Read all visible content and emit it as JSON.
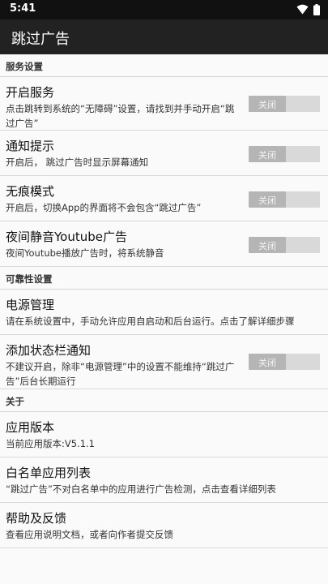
{
  "status_bar": {
    "time": "5:41"
  },
  "app_bar": {
    "title": "跳过广告"
  },
  "sections": {
    "service": {
      "title": "服务设置"
    },
    "reliability": {
      "title": "可靠性设置"
    },
    "about": {
      "title": "关于"
    }
  },
  "prefs": {
    "enable_service": {
      "title": "开启服务",
      "summary_line1": "点击跳转到系统的“无障碍”设置，请找到并手动开启“跳",
      "summary_line2": "过广告”",
      "toggle": "关闭"
    },
    "notification": {
      "title": "通知提示",
      "summary": "开启后， 跳过广告时显示屏幕通知",
      "toggle": "关闭"
    },
    "incognito": {
      "title": "无痕模式",
      "summary": "开启后，切换App的界面将不会包含“跳过广告”",
      "toggle": "关闭"
    },
    "night_mute": {
      "title": "夜间静音Youtube广告",
      "summary": "夜间Youtube播放广告时，将系统静音",
      "toggle": "关闭"
    },
    "power": {
      "title": "电源管理",
      "summary": "请在系统设置中，手动允许应用自启动和后台运行。点击了解详细步骤"
    },
    "status_notif": {
      "title": "添加状态栏通知",
      "summary_line1": "不建议开启，除非“电源管理”中的设置不能维持“跳过广",
      "summary_line2": "告”后台长期运行",
      "toggle": "关闭"
    },
    "version": {
      "title": "应用版本",
      "summary": "当前应用版本:V5.1.1"
    },
    "whitelist": {
      "title": "白名单应用列表",
      "summary": "“跳过广告”不对白名单中的应用进行广告检测，点击查看详细列表"
    },
    "help": {
      "title": "帮助及反馈",
      "summary": "查看应用说明文档，或者向作者提交反馈"
    }
  }
}
